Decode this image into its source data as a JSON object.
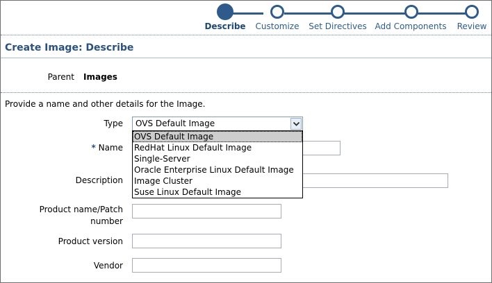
{
  "train": {
    "steps": [
      "Describe",
      "Customize",
      "Set Directives",
      "Add Components",
      "Review"
    ],
    "active_step": "Describe"
  },
  "header": {
    "title": "Create Image: Describe"
  },
  "parent": {
    "label": "Parent",
    "value": "Images"
  },
  "intro": "Provide a name and other details for the Image.",
  "form": {
    "type_label": "Type",
    "type_value": "OVS Default Image",
    "type_options": [
      "OVS Default Image",
      "RedHat Linux Default Image",
      "Single-Server",
      "Oracle Enterprise Linux Default Image",
      "Image Cluster",
      "Suse Linux Default Image"
    ],
    "name_required_mark": "*",
    "name_label": "Name",
    "description_label": "Description",
    "product_label_line1": "Product name/Patch",
    "product_label_line2": "number",
    "version_label": "Product version",
    "vendor_label": "Vendor"
  }
}
